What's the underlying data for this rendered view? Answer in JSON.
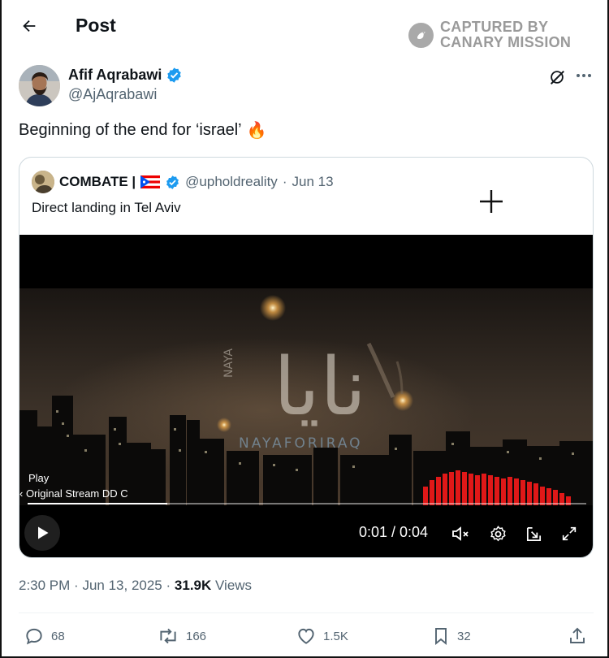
{
  "header": {
    "title": "Post",
    "back_icon": "arrow-left-icon"
  },
  "watermark": {
    "line1": "CAPTURED BY",
    "line2": "CANARY MISSION"
  },
  "author": {
    "name": "Afif Aqrabawi",
    "handle": "@AjAqrabawi",
    "verified": true
  },
  "post": {
    "text": "Beginning of the end for ‘israel’",
    "emoji": "🔥"
  },
  "quote": {
    "name": "COMBATE |",
    "flag": "puerto-rico-flag",
    "handle": "@upholdreality",
    "separator": "·",
    "date": "Jun 13",
    "text": "Direct landing in Tel Aviv",
    "video": {
      "overlay_arabic": "نايا",
      "overlay_latin": "NAYA",
      "overlay_brand": "NAYAFORIRAQ",
      "play_label": "Play",
      "stream_label": "‹ Original Stream  DD C",
      "time_display": "0:01 / 0:04",
      "progress": 0.25
    }
  },
  "meta": {
    "time": "2:30 PM",
    "sep1": "·",
    "date": "Jun 13, 2025",
    "sep2": "·",
    "views_count": "31.9K",
    "views_label": "Views"
  },
  "actions": {
    "replies": "68",
    "reposts": "166",
    "likes": "1.5K",
    "bookmarks": "32"
  },
  "colors": {
    "verified_blue": "#1d9bf0",
    "text_primary": "#0f1419",
    "text_secondary": "#536471",
    "border": "#cfd9de"
  }
}
